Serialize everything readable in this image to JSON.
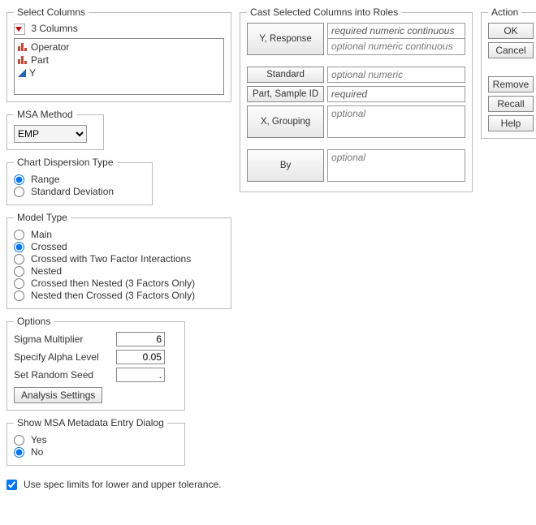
{
  "selectColumns": {
    "legend": "Select Columns",
    "count": "3 Columns",
    "items": [
      "Operator",
      "Part",
      "Y"
    ]
  },
  "msaMethod": {
    "legend": "MSA Method",
    "selected": "EMP"
  },
  "chartDispersion": {
    "legend": "Chart Dispersion Type",
    "options": [
      "Range",
      "Standard Deviation"
    ],
    "selected": "Range"
  },
  "modelType": {
    "legend": "Model Type",
    "options": [
      "Main",
      "Crossed",
      "Crossed with Two Factor Interactions",
      "Nested",
      "Crossed then Nested (3 Factors Only)",
      "Nested then Crossed (3 Factors Only)"
    ],
    "selected": "Crossed"
  },
  "options": {
    "legend": "Options",
    "sigmaLabel": "Sigma Multiplier",
    "sigmaValue": "6",
    "alphaLabel": "Specify Alpha Level",
    "alphaValue": "0.05",
    "seedLabel": "Set Random Seed",
    "seedValue": ".",
    "analysisBtn": "Analysis Settings"
  },
  "metadataDialog": {
    "legend": "Show MSA Metadata Entry Dialog",
    "options": [
      "Yes",
      "No"
    ],
    "selected": "No"
  },
  "specCheck": {
    "label": "Use spec limits for lower and upper tolerance.",
    "checked": true
  },
  "castRoles": {
    "legend": "Cast Selected Columns into Roles",
    "yresponse": {
      "btn": "Y, Response",
      "ph1": "required numeric continuous",
      "ph2": "optional numeric continuous"
    },
    "standard": {
      "btn": "Standard",
      "ph": "optional numeric"
    },
    "partid": {
      "btn": "Part, Sample ID",
      "ph": "required"
    },
    "xgroup": {
      "btn": "X, Grouping",
      "ph": "optional"
    },
    "by": {
      "btn": "By",
      "ph": "optional"
    }
  },
  "action": {
    "legend": "Action",
    "ok": "OK",
    "cancel": "Cancel",
    "remove": "Remove",
    "recall": "Recall",
    "help": "Help"
  }
}
